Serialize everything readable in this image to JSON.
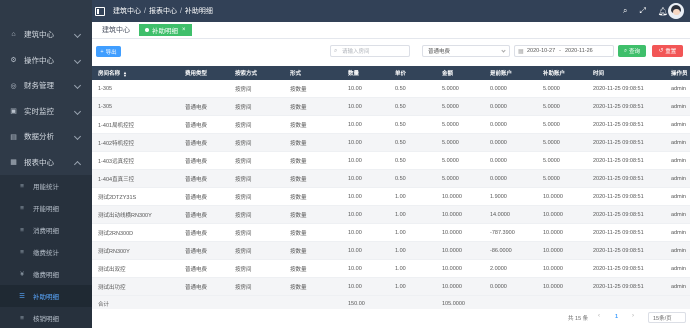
{
  "header": {
    "breadcrumb": [
      "建筑中心",
      "报表中心",
      "补助明细"
    ],
    "icons": [
      "search-icon",
      "expand-icon",
      "bell-icon"
    ]
  },
  "tabs": [
    {
      "label": "建筑中心",
      "active": false
    },
    {
      "label": "补助明细",
      "active": true
    }
  ],
  "sidebar": {
    "items": [
      {
        "label": "建筑中心",
        "icon": "building-icon"
      },
      {
        "label": "操作中心",
        "icon": "cog-icon"
      },
      {
        "label": "财务管理",
        "icon": "finance-icon"
      },
      {
        "label": "实时监控",
        "icon": "monitor-icon"
      },
      {
        "label": "数据分析",
        "icon": "chart-icon"
      },
      {
        "label": "报表中心",
        "icon": "report-icon",
        "open": true
      }
    ],
    "subitems": [
      {
        "label": "用能统计",
        "icon": "stats-icon"
      },
      {
        "label": "开能明细",
        "icon": "detail-icon"
      },
      {
        "label": "消费明细",
        "icon": "consume-icon"
      },
      {
        "label": "缴费统计",
        "icon": "pay-icon"
      },
      {
        "label": "缴费明细",
        "icon": "pay-detail-icon"
      },
      {
        "label": "补助明细",
        "icon": "list-icon",
        "active": true
      },
      {
        "label": "核销明细",
        "icon": "verify-icon"
      }
    ]
  },
  "toolbar": {
    "export_label": "导出",
    "search_placeholder": "请输入房间",
    "fee_type": "普通电费",
    "date_start": "2020-10-27",
    "date_sep": "-",
    "date_end": "2020-11-26",
    "query_label": "查询",
    "reset_label": "重置"
  },
  "table": {
    "columns": [
      "房间名称",
      "费用类型",
      "按索方式",
      "形式",
      "数量",
      "单价",
      "金额",
      "是前账户",
      "补助账户",
      "时间",
      "操作员"
    ],
    "rows": [
      [
        "1-305",
        "",
        "按房间",
        "按数量",
        "10.00",
        "0.50",
        "5.0000",
        "0.0000",
        "5.0000",
        "2020-11-25 09:08:51",
        "admin"
      ],
      [
        "1-305",
        "普通电费",
        "按房间",
        "按数量",
        "10.00",
        "0.50",
        "5.0000",
        "0.0000",
        "5.0000",
        "2020-11-25 09:08:51",
        "admin"
      ],
      [
        "1-401局机控控",
        "普通电费",
        "按房间",
        "按数量",
        "10.00",
        "0.50",
        "5.0000",
        "0.0000",
        "5.0000",
        "2020-11-25 09:08:51",
        "admin"
      ],
      [
        "1-402特机控控",
        "普通电费",
        "按房间",
        "按数量",
        "10.00",
        "0.50",
        "5.0000",
        "0.0000",
        "5.0000",
        "2020-11-25 09:08:51",
        "admin"
      ],
      [
        "1-403远真控控",
        "普通电费",
        "按房间",
        "按数量",
        "10.00",
        "0.50",
        "5.0000",
        "0.0000",
        "5.0000",
        "2020-11-25 09:08:51",
        "admin"
      ],
      [
        "1-404直真三控",
        "普通电费",
        "按房间",
        "按数量",
        "10.00",
        "0.50",
        "5.0000",
        "0.0000",
        "5.0000",
        "2020-11-25 09:08:51",
        "admin"
      ],
      [
        "测试2DTZY31S",
        "普通电费",
        "按房间",
        "按数量",
        "10.00",
        "1.00",
        "10.0000",
        "1.9000",
        "10.0000",
        "2020-11-25 09:08:51",
        "admin"
      ],
      [
        "测试出动线横RN300Y",
        "普通电费",
        "按房间",
        "按数量",
        "10.00",
        "1.00",
        "10.0000",
        "14.0000",
        "10.0000",
        "2020-11-25 09:08:51",
        "admin"
      ],
      [
        "测试2RN300D",
        "普通电费",
        "按房间",
        "按数量",
        "10.00",
        "1.00",
        "10.0000",
        "-787.3900",
        "10.0000",
        "2020-11-25 09:08:51",
        "admin"
      ],
      [
        "测试RN300Y",
        "普通电费",
        "按房间",
        "按数量",
        "10.00",
        "1.00",
        "10.0000",
        "-86.0000",
        "10.0000",
        "2020-11-25 09:08:51",
        "admin"
      ],
      [
        "测试出双控",
        "普通电费",
        "按房间",
        "按数量",
        "10.00",
        "1.00",
        "10.0000",
        "2.0000",
        "10.0000",
        "2020-11-25 09:08:51",
        "admin"
      ],
      [
        "测试出功控",
        "普通电费",
        "按房间",
        "按数量",
        "10.00",
        "1.00",
        "10.0000",
        "0.0000",
        "10.0000",
        "2020-11-25 09:08:51",
        "admin"
      ]
    ],
    "total": {
      "label": "合计",
      "quantity": "150.00",
      "amount": "105.0000"
    }
  },
  "pager": {
    "total_text": "共 15 条",
    "current_page": "1",
    "page_size": "15条/页"
  }
}
